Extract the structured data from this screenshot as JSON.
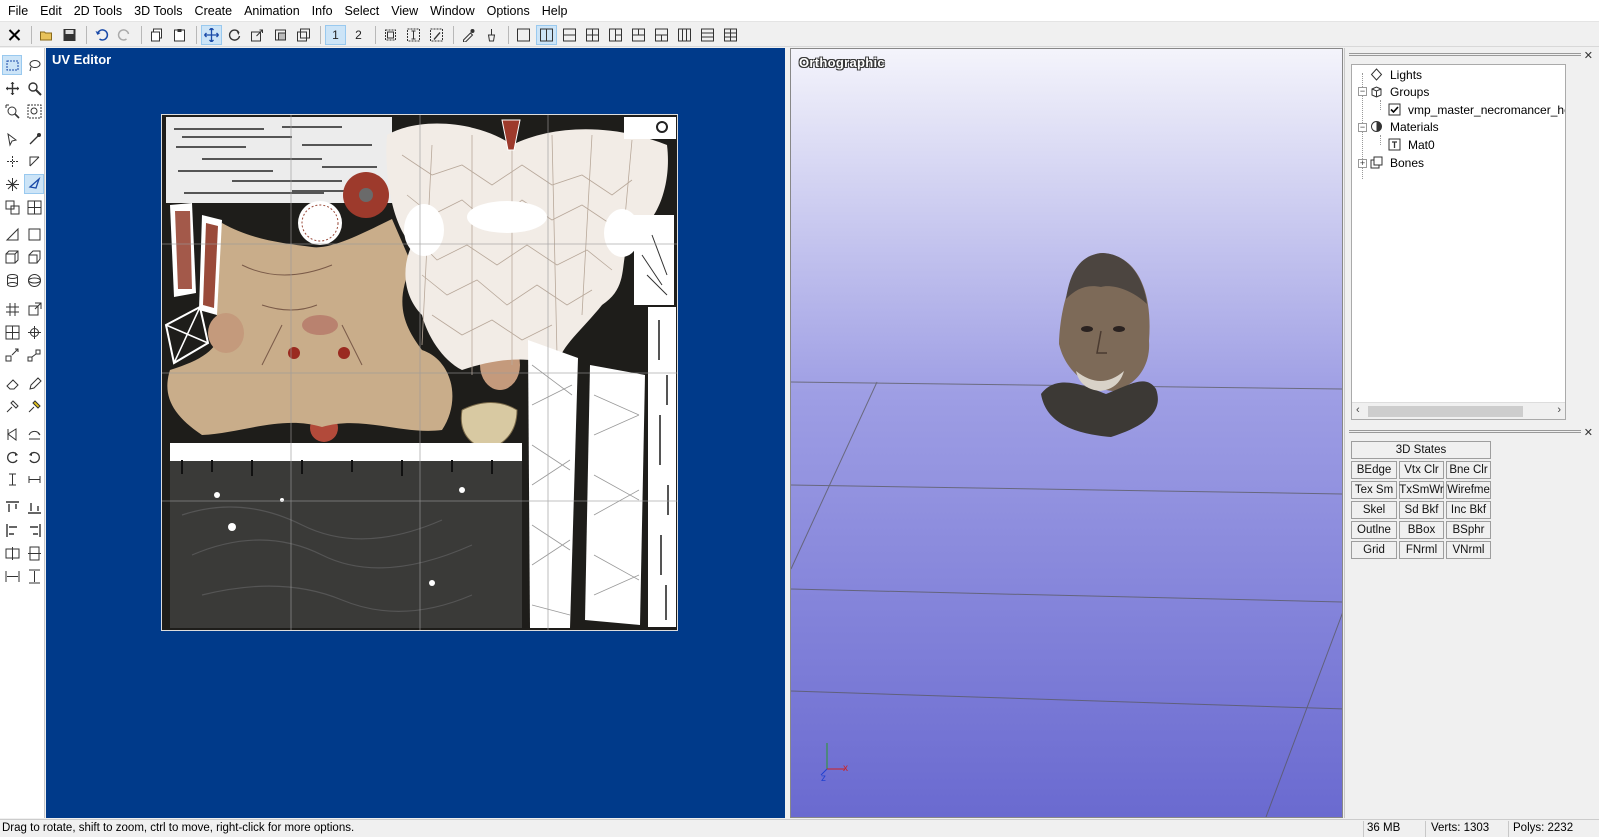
{
  "menu": [
    "File",
    "Edit",
    "2D Tools",
    "3D Tools",
    "Create",
    "Animation",
    "Info",
    "Select",
    "View",
    "Window",
    "Options",
    "Help"
  ],
  "toolbar": {
    "view_1_label": "1",
    "view_2_label": "2",
    "icons": [
      "close-icon",
      "open-folder-icon",
      "save-icon",
      "undo-icon",
      "redo-icon",
      "copy-icon",
      "paste-icon",
      "move-icon",
      "rotate-icon",
      "scale-icon",
      "select-face-icon",
      "select-group-icon",
      "select-box-icon",
      "select-text-icon",
      "edit-icon",
      "eyedropper-icon",
      "paint-icon",
      "layout-single-icon",
      "layout-split-v-icon",
      "layout-split-h-icon",
      "layout-quad-icon",
      "layout-3a-icon",
      "layout-3b-icon",
      "layout-3c-icon",
      "layout-cols-icon",
      "layout-rows-icon",
      "layout-grid-icon"
    ]
  },
  "uv_editor": {
    "title": "UV Editor"
  },
  "viewport": {
    "title": "Orthographic"
  },
  "tree": {
    "items": [
      {
        "label": "Lights",
        "icon": "diamond-icon"
      },
      {
        "label": "Groups",
        "icon": "cube-icon"
      },
      {
        "label": "vmp_master_necromancer_head",
        "icon": "checkbox-checked-icon",
        "checked": true
      },
      {
        "label": "Materials",
        "icon": "sphere-icon"
      },
      {
        "label": "Mat0",
        "icon": "texture-icon"
      },
      {
        "label": "Bones",
        "icon": "bones-icon"
      }
    ]
  },
  "states": {
    "header": "3D States",
    "buttons": [
      "BEdge",
      "Vtx Clr",
      "Bne Clr",
      "Tex Sm",
      "TxSmWr",
      "Wirefme",
      "Skel",
      "Sd Bkf",
      "Inc Bkf",
      "Outlne",
      "BBox",
      "BSphr",
      "Grid",
      "FNrml",
      "VNrml"
    ]
  },
  "status": {
    "hint": "Drag to rotate, shift to zoom, ctrl to move, right-click for more options.",
    "memory": "36 MB",
    "verts": "Verts: 1303",
    "polys": "Polys: 2232"
  },
  "colors": {
    "uv_background": "#003a8a",
    "viewport_top": "#f4f4fb",
    "viewport_bottom": "#6a6ad0",
    "active_tool": "#cce4f7"
  }
}
